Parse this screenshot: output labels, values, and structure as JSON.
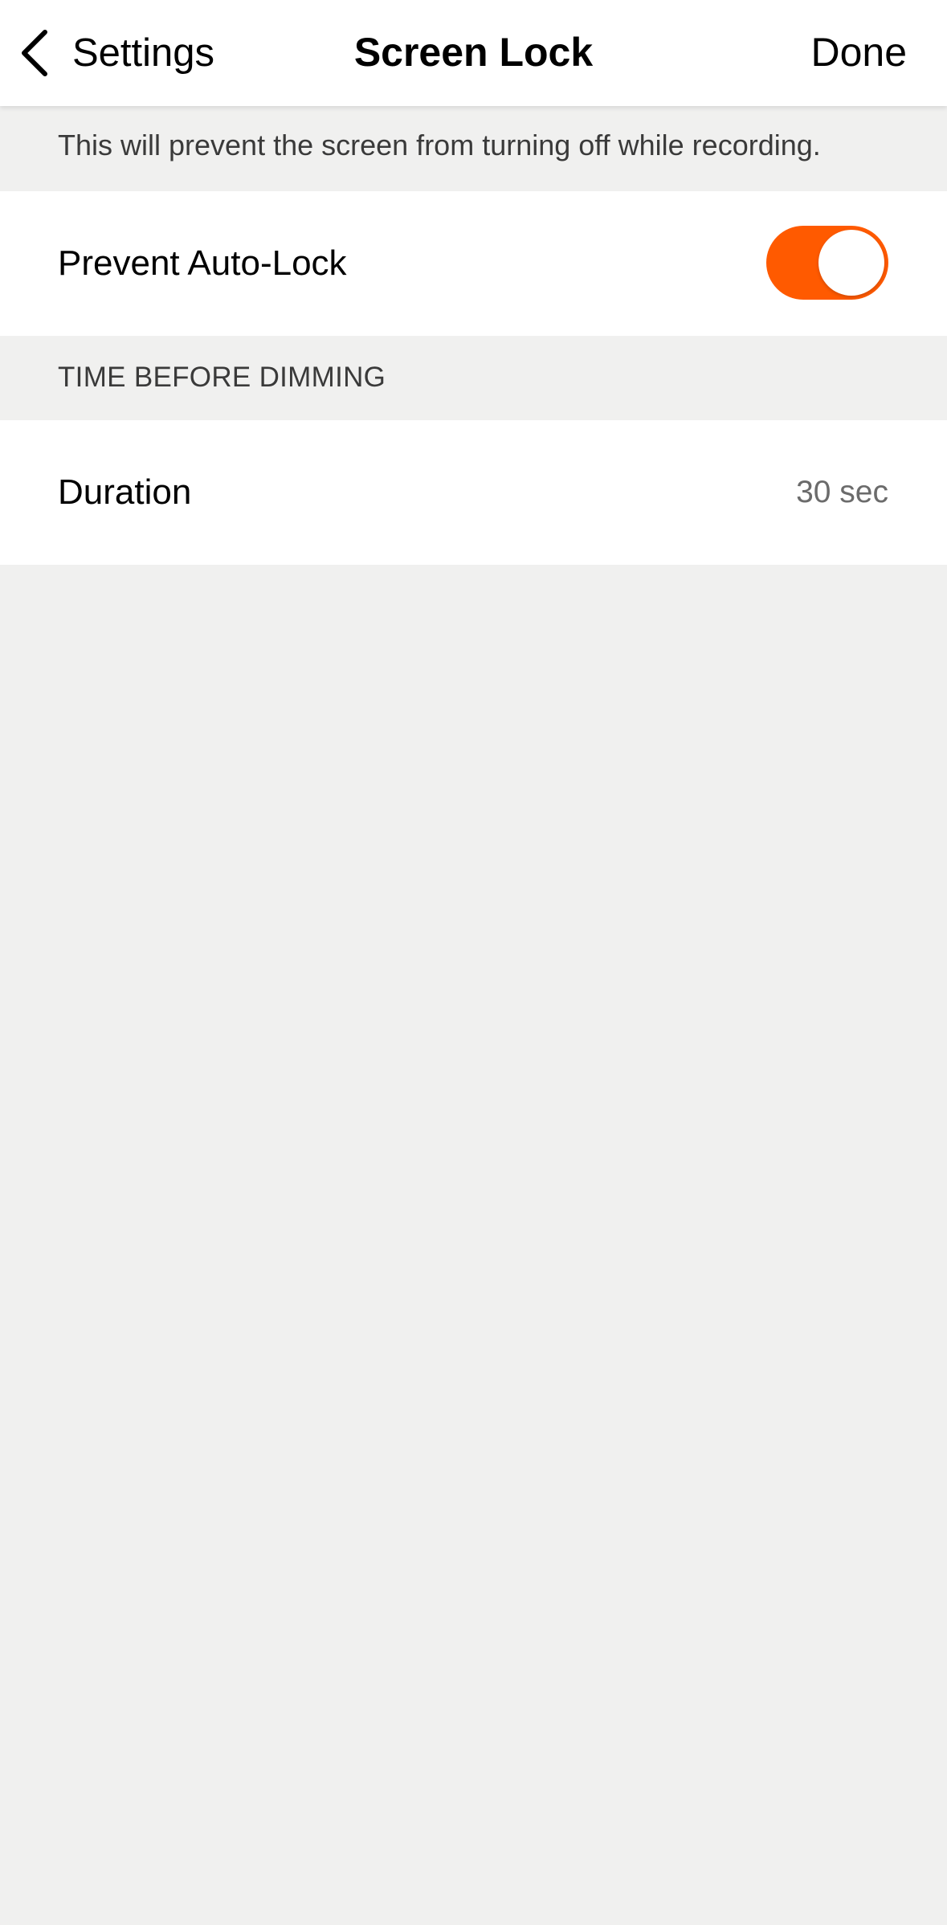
{
  "navbar": {
    "back_label": "Settings",
    "title": "Screen Lock",
    "done_label": "Done",
    "back_icon": "chevron-left-icon"
  },
  "description": "This will prevent the screen from turning off while recording.",
  "auto_lock": {
    "label": "Prevent Auto-Lock",
    "enabled": true,
    "toggle_color": "#ff5a00"
  },
  "dimming_section": {
    "header": "TIME BEFORE DIMMING",
    "duration_label": "Duration",
    "duration_value": "30 sec"
  }
}
